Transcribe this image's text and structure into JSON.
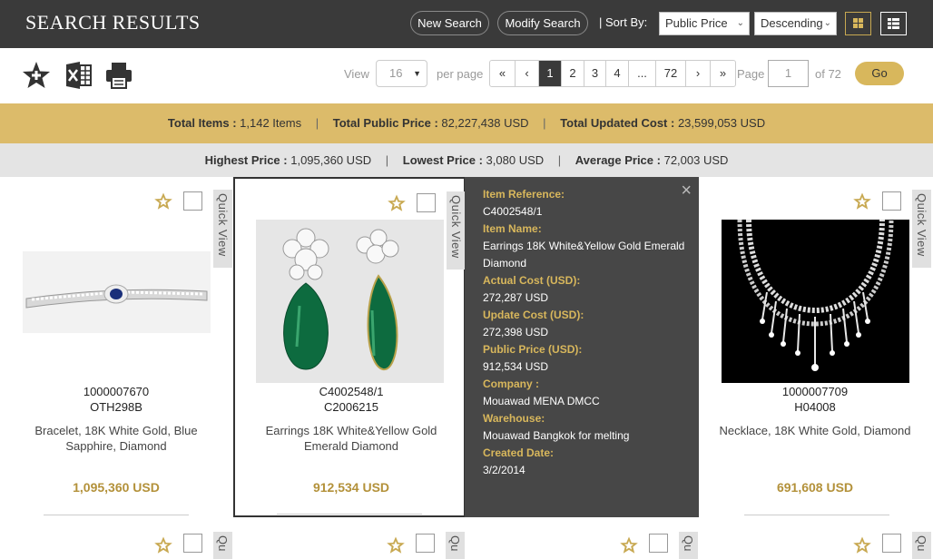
{
  "header": {
    "title": "SEARCH RESULTS",
    "new_search": "New Search",
    "modify_search": "Modify Search",
    "sort_by_label": "| Sort By:",
    "sort_field": "Public Price",
    "sort_order": "Descending"
  },
  "toolbar": {
    "view_label": "View",
    "per_page_value": "16",
    "per_page_label": "per page",
    "pages": [
      "«",
      "‹",
      "1",
      "2",
      "3",
      "4",
      "...",
      "72",
      "›",
      "»"
    ],
    "active_page": "1",
    "page_label": "Page",
    "page_input_value": "1",
    "of_pages": "of 72",
    "go_label": "Go"
  },
  "summary": {
    "total_items_label": "Total Items :",
    "total_items_value": "1,142 Items",
    "total_public_label": "Total Public Price :",
    "total_public_value": "82,227,438 USD",
    "total_updated_label": "Total Updated Cost :",
    "total_updated_value": "23,599,053 USD",
    "highest_label": "Highest Price :",
    "highest_value": "1,095,360 USD",
    "lowest_label": "Lowest Price :",
    "lowest_value": "3,080 USD",
    "average_label": "Average Price :",
    "average_value": "72,003 USD"
  },
  "quick_view_label": "Quick View",
  "peek_quick_view_label": "Qu",
  "products": [
    {
      "ref": "1000007670",
      "code": "OTH298B",
      "name": "Bracelet, 18K White Gold, Blue Sapphire, Diamond",
      "price": "1,095,360 USD"
    },
    {
      "ref": "C4002548/1",
      "code": "C2006215",
      "name": "Earrings 18K White&Yellow Gold Emerald Diamond",
      "price": "912,534 USD"
    },
    {
      "ref": "1000007709",
      "code": "H04008",
      "name": "Necklace, 18K White Gold, Diamond",
      "price": "691,608 USD"
    }
  ],
  "quick_view": {
    "close": "×",
    "fields": [
      {
        "label": "Item Reference:",
        "value": "C4002548/1"
      },
      {
        "label": "Item Name:",
        "value": "Earrings 18K White&Yellow Gold Emerald Diamond"
      },
      {
        "label": "Actual Cost (USD):",
        "value": "272,287 USD"
      },
      {
        "label": "Update Cost (USD):",
        "value": "272,398 USD"
      },
      {
        "label": "Public Price (USD):",
        "value": "912,534 USD"
      },
      {
        "label": "Company :",
        "value": "Mouawad MENA DMCC"
      },
      {
        "label": "Warehouse:",
        "value": "Mouawad Bangkok for melting"
      },
      {
        "label": "Created Date:",
        "value": "3/2/2014"
      }
    ]
  },
  "colors": {
    "header_bg": "#3a3a3a",
    "accent_gold": "#dcbb6a",
    "price_gold": "#b3913a",
    "overlay_bg": "#474747"
  }
}
